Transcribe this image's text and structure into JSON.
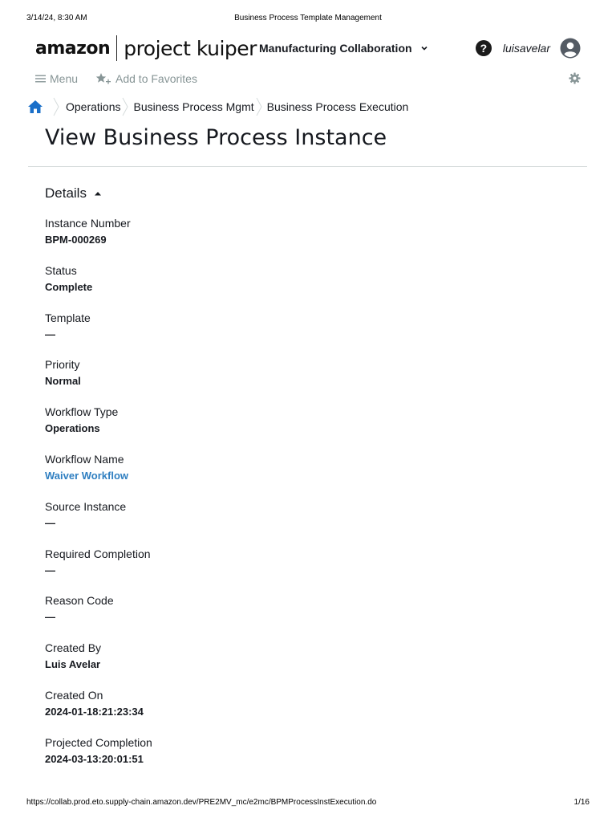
{
  "print_header": {
    "datetime": "3/14/24, 8:30 AM",
    "title": "Business Process Template Management"
  },
  "header": {
    "logo_amazon": "amazon",
    "logo_product": "project kuiper",
    "project_selector": "Manufacturing Collaboration",
    "username": "luisavelar"
  },
  "subbar": {
    "menu_label": "Menu",
    "favorites_label": "Add to Favorites"
  },
  "breadcrumb": [
    "Operations",
    "Business Process Mgmt",
    "Business Process Execution"
  ],
  "page_title": "View Business Process Instance",
  "details": {
    "section_title": "Details",
    "fields": [
      {
        "label": "Instance Number",
        "value": "BPM-000269"
      },
      {
        "label": "Status",
        "value": "Complete"
      },
      {
        "label": "Template",
        "value": "—"
      },
      {
        "label": "Priority",
        "value": "Normal"
      },
      {
        "label": "Workflow Type",
        "value": "Operations"
      },
      {
        "label": "Workflow Name",
        "value": "Waiver Workflow"
      },
      {
        "label": "Source Instance",
        "value": "—"
      },
      {
        "label": "Required Completion",
        "value": "—"
      },
      {
        "label": "Reason Code",
        "value": "—"
      },
      {
        "label": "Created By",
        "value": "Luis Avelar"
      },
      {
        "label": "Created On",
        "value": "2024-01-18:21:23:34"
      },
      {
        "label": "Projected Completion",
        "value": "2024-03-13:20:01:51"
      }
    ]
  },
  "print_footer": {
    "url": "https://collab.prod.eto.supply-chain.amazon.dev/PRE2MV_mc/e2mc/BPMProcessInstExecution.do",
    "page": "1/16"
  },
  "colors": {
    "link": "#2f7fc1",
    "home_icon": "#1a6fc9",
    "muted": "#879596",
    "divider": "#d5dbdb"
  },
  "icons": {
    "help": "question-circle-icon",
    "user": "user-circle-icon",
    "menu": "hamburger-icon",
    "favorite": "star-plus-icon",
    "settings": "gear-icon",
    "home": "home-icon",
    "section_toggle": "caret-up-icon",
    "project_dropdown": "chevron-down-icon"
  }
}
